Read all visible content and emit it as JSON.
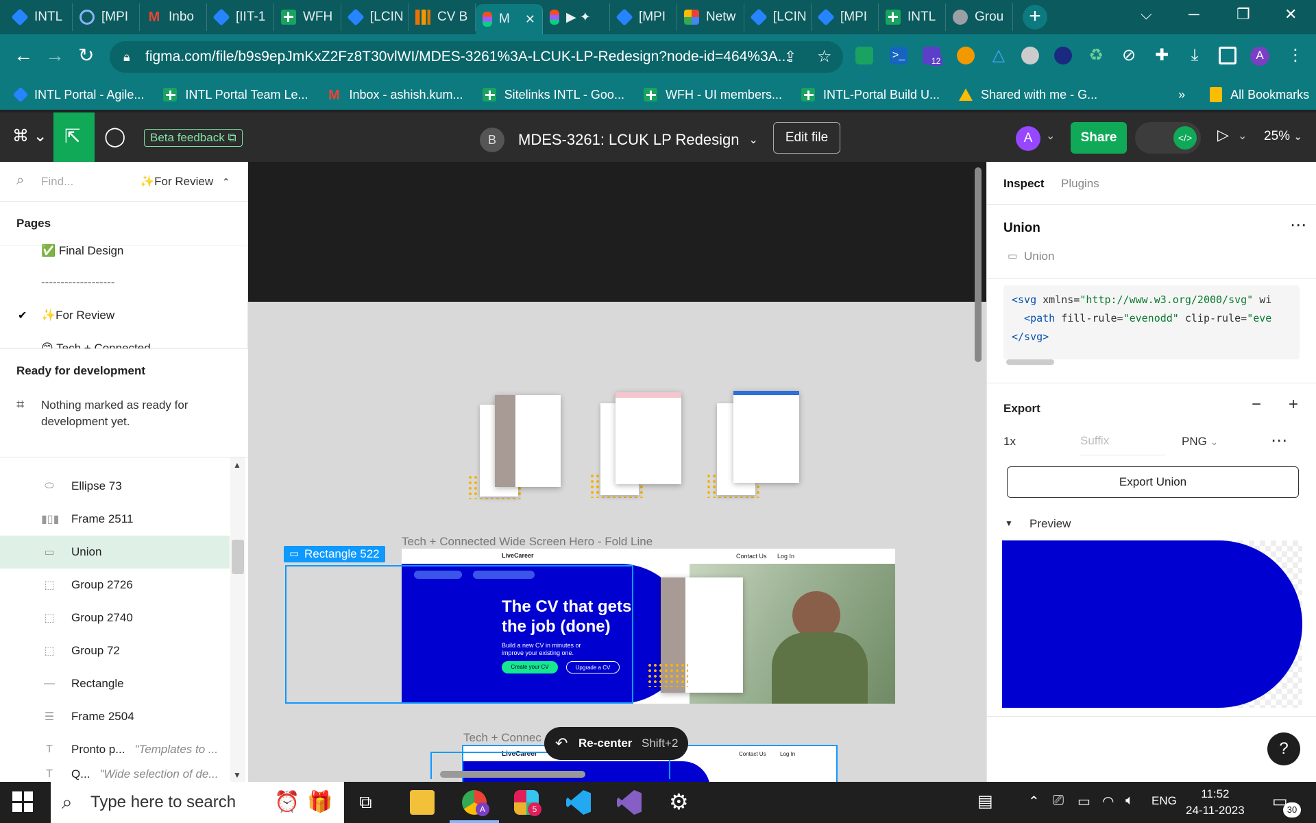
{
  "browser": {
    "tabs": [
      {
        "label": "INTL",
        "icon": "jira-icon"
      },
      {
        "label": "[MPI",
        "icon": "mpi-icon"
      },
      {
        "label": "Inbo",
        "icon": "gmail-icon"
      },
      {
        "label": "[IIT-1",
        "icon": "jira-icon"
      },
      {
        "label": "WFH",
        "icon": "sheets-icon"
      },
      {
        "label": "[LCIN",
        "icon": "jira-icon"
      },
      {
        "label": "CV B",
        "icon": "chart-icon"
      },
      {
        "label": "M",
        "icon": "figma-icon",
        "active": true
      },
      {
        "label": "▶ ✦",
        "icon": "figma-icon"
      },
      {
        "label": "[MPI",
        "icon": "jira-icon"
      },
      {
        "label": "Netw",
        "icon": "network-icon"
      },
      {
        "label": "[LCIN",
        "icon": "jira-icon"
      },
      {
        "label": "[MPI",
        "icon": "jira-icon"
      },
      {
        "label": "INTL",
        "icon": "sheets-icon"
      },
      {
        "label": "Grou",
        "icon": "globe-icon"
      }
    ],
    "close_glyph": "✕",
    "new_tab": "+",
    "url": "figma.com/file/b9s9epJmKxZ2Fz8T30vlWI/MDES-3261%3A-LCUK-LP-Redesign?node-id=464%3A...",
    "extension_badge": "12",
    "profile_initial": "A",
    "bookmarks": [
      {
        "label": "INTL Portal - Agile...",
        "icon": "jira-icon"
      },
      {
        "label": "INTL Portal Team Le...",
        "icon": "sheets-icon"
      },
      {
        "label": "Inbox - ashish.kum...",
        "icon": "gmail-icon"
      },
      {
        "label": "Sitelinks INTL - Goo...",
        "icon": "sheets-icon"
      },
      {
        "label": "WFH - UI members...",
        "icon": "sheets-icon"
      },
      {
        "label": "INTL-Portal Build U...",
        "icon": "sheets-icon"
      },
      {
        "label": "Shared with me - G...",
        "icon": "drive-icon"
      }
    ],
    "more_bookmarks": "»",
    "all_bookmarks": "All Bookmarks"
  },
  "figma_toolbar": {
    "beta_feedback": "Beta feedback",
    "owner_initial": "B",
    "file_title": "MDES-3261: LCUK LP Redesign",
    "edit_file": "Edit file",
    "user_initial": "A",
    "share": "Share",
    "zoom": "25%"
  },
  "left_panel": {
    "find_placeholder": "Find...",
    "current_page": "For Review",
    "pages_heading": "Pages",
    "pages": [
      {
        "label": "✅ Final Design"
      },
      {
        "label": "-------------------"
      },
      {
        "label": "For Review",
        "checked": true
      },
      {
        "label": "Tech + Connected"
      }
    ],
    "ready_heading": "Ready for development",
    "ready_message_line1": "Nothing marked as ready for",
    "ready_message_line2": "development yet.",
    "layers": [
      {
        "name": "Ellipse 73",
        "icon": "ellipse-icon"
      },
      {
        "name": "Frame 2511",
        "icon": "frame-icon"
      },
      {
        "name": "Union",
        "icon": "union-icon",
        "selected": true
      },
      {
        "name": "Group 2726",
        "icon": "group-icon"
      },
      {
        "name": "Group 2740",
        "icon": "group-icon"
      },
      {
        "name": "Group 72",
        "icon": "group-icon"
      },
      {
        "name": "Rectangle",
        "icon": "rectangle-icon"
      },
      {
        "name": "Frame 2504",
        "icon": "frame-icon"
      },
      {
        "name": "Pronto p...",
        "sub": "\"Templates to ...",
        "icon": "text-icon"
      },
      {
        "name": "Q...",
        "sub": "\"Wide selection of de...",
        "icon": "text-icon"
      }
    ]
  },
  "canvas": {
    "frame_label": "Tech + Connected Wide Screen Hero - Fold Line",
    "rect_label": "Rectangle 522",
    "hero_logo": "LiveCareer",
    "hero_contact": "Contact Us",
    "hero_login": "Log In",
    "hero_headline": "The CV that gets the job (done)",
    "hero_subline": "Build a new CV in minutes or improve your existing one.",
    "hero_btn_primary": "Create your CV",
    "hero_btn_secondary": "Upgrade a CV",
    "second_frame_label": "Tech + Connec",
    "recenter_label": "Re-center",
    "recenter_shortcut": "Shift+2"
  },
  "right_panel": {
    "tab_inspect": "Inspect",
    "tab_plugins": "Plugins",
    "selection_title": "Union",
    "selection_type": "Union",
    "code_line1_tag": "<svg",
    "code_line1_attr": " xmlns=",
    "code_line1_val": "\"http://www.w3.org/2000/svg\"",
    "code_line1_rest": " wi",
    "code_line2_tag": "  <path",
    "code_line2_attr1": " fill-rule=",
    "code_line2_val1": "\"evenodd\"",
    "code_line2_attr2": " clip-rule=",
    "code_line2_val2": "\"eve",
    "code_line3": "</svg>",
    "export_heading": "Export",
    "export_scale": "1x",
    "export_suffix_placeholder": "Suffix",
    "export_format": "PNG",
    "export_button": "Export Union",
    "preview_label": "Preview",
    "preview_color": "#0000d0",
    "help": "?"
  },
  "taskbar": {
    "search_placeholder": "Type here to search",
    "chrome_badge": "A",
    "slack_badge": "5",
    "language": "ENG",
    "time": "11:52",
    "date": "24-11-2023",
    "notification_count": "30"
  }
}
